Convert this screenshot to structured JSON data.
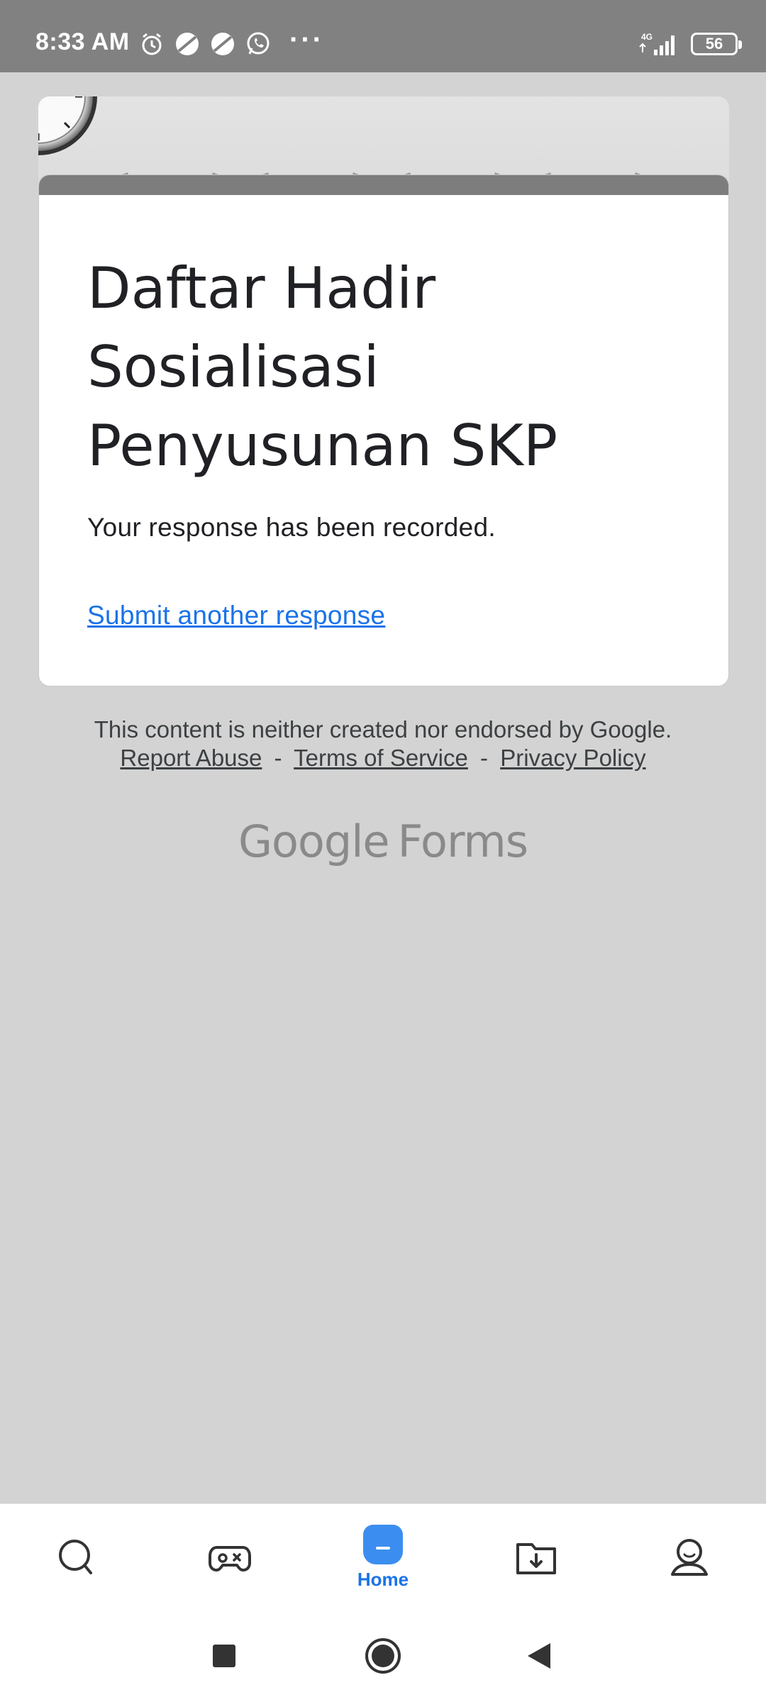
{
  "status_bar": {
    "time": "8:33 AM",
    "icons_left": [
      "alarm-icon",
      "app-icon",
      "app-icon",
      "whatsapp-icon"
    ],
    "more": "···",
    "network": "4G",
    "battery": "56"
  },
  "form": {
    "title": "Daftar Hadir Sosialisasi Penyusunan SKP",
    "confirmation": "Your response has been recorded.",
    "submit_another": "Submit another response"
  },
  "footer": {
    "disclaimer": "This content is neither created nor endorsed by Google.",
    "report_abuse": "Report Abuse",
    "terms": "Terms of Service",
    "privacy": "Privacy Policy",
    "separator": "-",
    "brand_google": "Google",
    "brand_forms": "Forms"
  },
  "bottom_nav": {
    "items": [
      {
        "icon": "search-icon"
      },
      {
        "icon": "gamepad-icon"
      },
      {
        "icon": "home-icon",
        "label": "Home",
        "active": true
      },
      {
        "icon": "download-folder-icon"
      },
      {
        "icon": "profile-icon"
      }
    ]
  },
  "colors": {
    "accent": "#1a73e8",
    "status_bar": "#818181",
    "background": "#d3d3d3"
  }
}
